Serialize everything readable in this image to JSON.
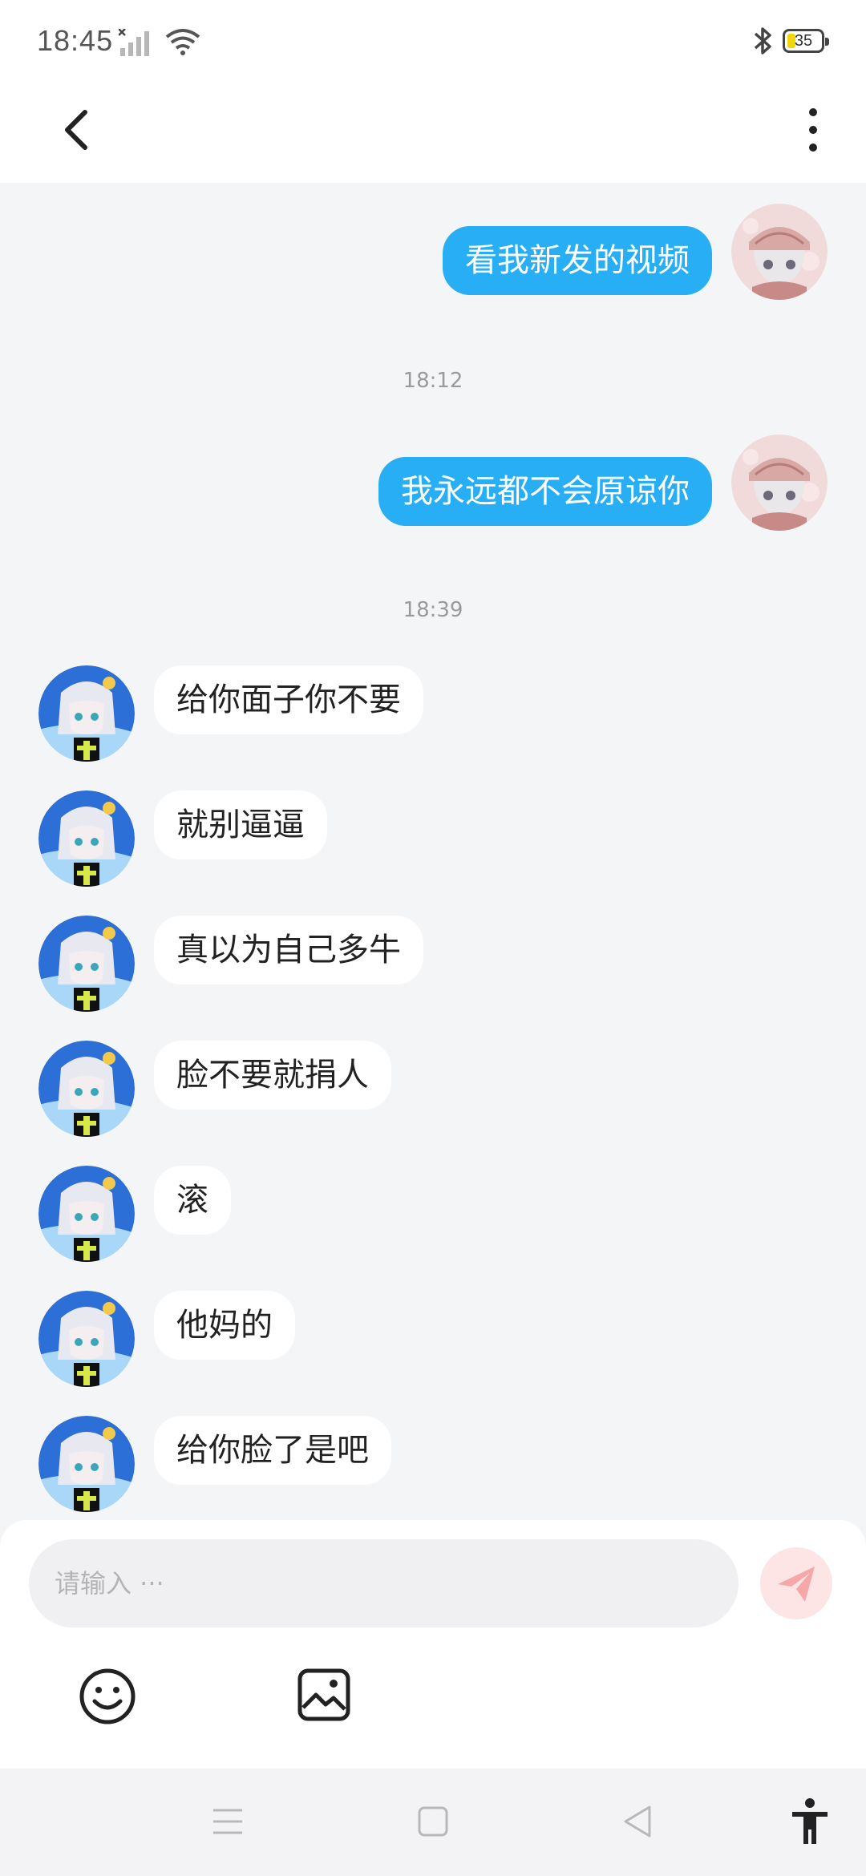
{
  "status_bar": {
    "time": "18:45",
    "battery_level": "35",
    "icons": [
      "signal-icon",
      "wifi-icon",
      "bluetooth-icon",
      "battery-icon"
    ]
  },
  "header": {
    "back_icon": "chevron-left-icon",
    "more_icon": "more-vertical-icon"
  },
  "messages": [
    {
      "type": "sent",
      "text": "看我新发的视频"
    },
    {
      "type": "timestamp",
      "text": "18:12"
    },
    {
      "type": "sent",
      "text": "我永远都不会原谅你"
    },
    {
      "type": "timestamp",
      "text": "18:39"
    },
    {
      "type": "received",
      "text": "给你面子你不要"
    },
    {
      "type": "received",
      "text": "就别逼逼"
    },
    {
      "type": "received",
      "text": "真以为自己多牛"
    },
    {
      "type": "received",
      "text": "脸不要就捐人"
    },
    {
      "type": "received",
      "text": "滚"
    },
    {
      "type": "received",
      "text": "他妈的"
    },
    {
      "type": "received",
      "text": "给你脸了是吧"
    }
  ],
  "input": {
    "placeholder": "请输入 ···",
    "value": ""
  },
  "toolbar": {
    "send_icon": "send-icon",
    "emoji_icon": "emoji-icon",
    "image_icon": "image-icon"
  },
  "nav_bar": {
    "icons": [
      "menu-icon",
      "home-icon",
      "back-icon",
      "accessibility-icon"
    ]
  },
  "colors": {
    "sent_bubble": "#27aef4",
    "received_bubble": "#ffffff",
    "background": "#f4f5f7",
    "send_button": "#fde5e5",
    "send_icon": "#f6a7a7"
  }
}
